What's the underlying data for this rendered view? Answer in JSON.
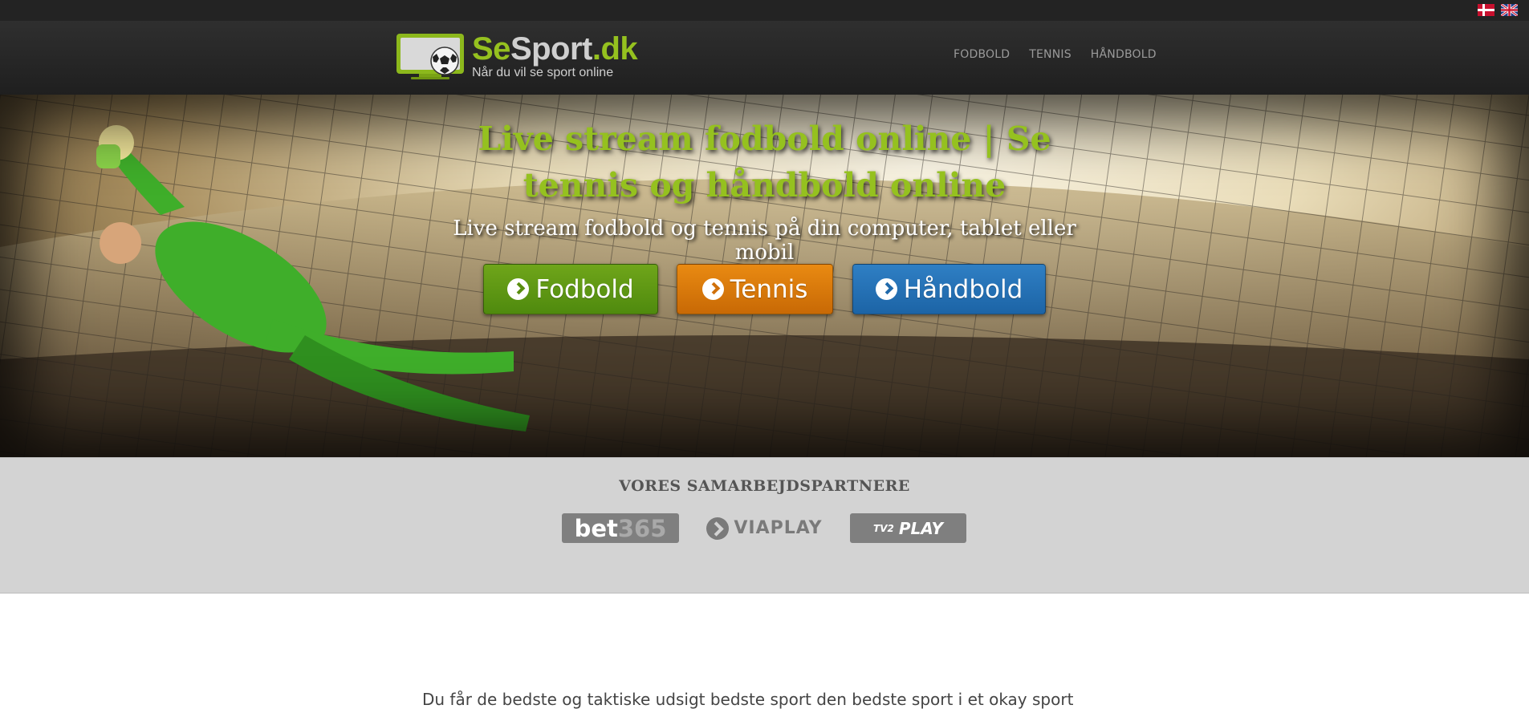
{
  "flags": {
    "danish": "flag-dk-icon",
    "english": "flag-gb-icon"
  },
  "header": {
    "brand_se": "Se",
    "brand_sport": "Sport",
    "brand_tld": ".dk",
    "tagline": "Når du vil se sport online",
    "nav": [
      "FODBOLD",
      "TENNIS",
      "HÅNDBOLD"
    ]
  },
  "hero": {
    "title": "Live stream fodbold online | Se tennis og håndbold online",
    "subtitle": "Live stream fodbold og tennis på din computer, tablet eller mobil",
    "buttons": [
      {
        "label": "Fodbold",
        "color": "#5a8f10"
      },
      {
        "label": "Tennis",
        "color": "#d0700a"
      },
      {
        "label": "Håndbold",
        "color": "#216aab"
      }
    ]
  },
  "partners": {
    "title": "VORES SAMARBEJDSPARTNERE",
    "bet365_a": "bet",
    "bet365_b": "365",
    "viaplay": "VIAPLAY",
    "tv2_a": "TV2",
    "tv2_b": "PLAY"
  },
  "body": {
    "partial_text": "Du får de bedste og taktiske udsigt bedste sport den bedste sport i et okay sport"
  },
  "colors": {
    "accent": "#95c11f",
    "topbar": "#232323",
    "partners_bg": "#d3d3d3"
  }
}
